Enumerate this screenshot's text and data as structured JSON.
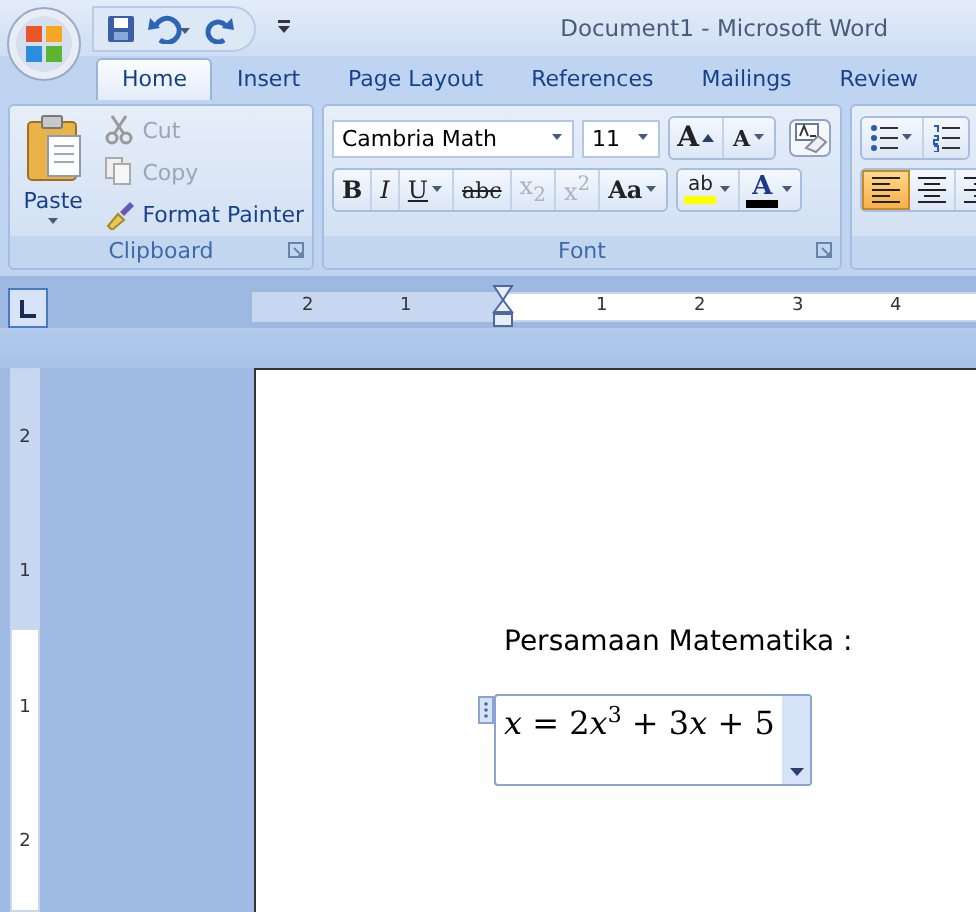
{
  "window": {
    "title": "Document1 - Microsoft Word"
  },
  "tabs": [
    {
      "label": "Home",
      "selected": true
    },
    {
      "label": "Insert",
      "selected": false
    },
    {
      "label": "Page Layout",
      "selected": false
    },
    {
      "label": "References",
      "selected": false
    },
    {
      "label": "Mailings",
      "selected": false
    },
    {
      "label": "Review",
      "selected": false
    }
  ],
  "clipboard": {
    "title": "Clipboard",
    "paste": "Paste",
    "items": [
      {
        "label": "Cut",
        "kind": "cut",
        "disabled": true
      },
      {
        "label": "Copy",
        "kind": "copy",
        "disabled": true
      },
      {
        "label": "Format Painter",
        "kind": "painter",
        "disabled": false
      }
    ]
  },
  "font": {
    "title": "Font",
    "font_name": "Cambria Math",
    "font_size": "11",
    "size_buttons": [
      {
        "label": "A",
        "kind": "grow"
      },
      {
        "label": "A",
        "kind": "shrink"
      }
    ],
    "format_buttons": [
      {
        "label": "B",
        "kind": "bold",
        "disabled": false
      },
      {
        "label": "I",
        "kind": "italic",
        "disabled": false
      },
      {
        "label": "U",
        "kind": "underline",
        "disabled": false
      },
      {
        "label": "abc",
        "kind": "strike",
        "disabled": false
      },
      {
        "label": "x$_{2}$",
        "kind": "subscript",
        "disabled": true
      },
      {
        "label": "x$^{2}$",
        "kind": "superscript",
        "disabled": true
      },
      {
        "label": "Aa",
        "kind": "case",
        "disabled": false
      }
    ],
    "highlight": {
      "label": "ab",
      "color": "#ffff00"
    },
    "font_color": {
      "label": "A",
      "color": "#000000"
    }
  },
  "paragraph": {
    "align_buttons": [
      {
        "kind": "left",
        "selected": true
      },
      {
        "kind": "center",
        "selected": false
      },
      {
        "kind": "right",
        "selected": false
      }
    ]
  },
  "ruler": {
    "labels": [
      "2",
      "1",
      "1",
      "2",
      "3",
      "4"
    ]
  },
  "vertical_ruler": {
    "labels": [
      "2",
      "1",
      "1",
      "2"
    ]
  },
  "document": {
    "heading": "Persamaan Matematika :",
    "equation": [
      {
        "text": "x",
        "kind": "var"
      },
      {
        "text": " = 2",
        "kind": "plain"
      },
      {
        "text": "x",
        "kind": "var"
      },
      {
        "text": "3",
        "kind": "sup"
      },
      {
        "text": " + 3",
        "kind": "plain"
      },
      {
        "text": "x",
        "kind": "var"
      },
      {
        "text": " + 5",
        "kind": "plain"
      }
    ]
  }
}
